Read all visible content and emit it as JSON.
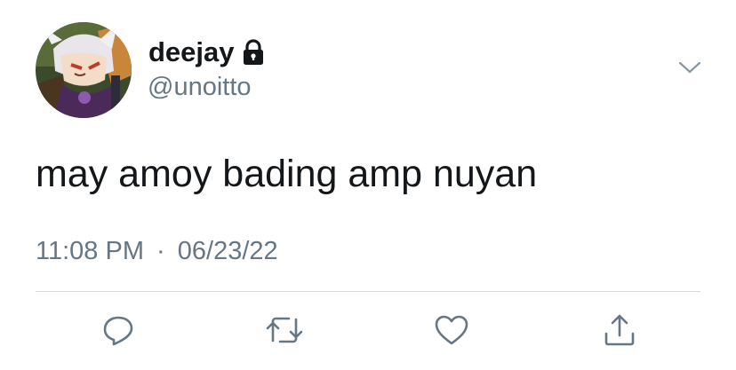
{
  "tweet": {
    "display_name": "deejay",
    "handle": "@unoitto",
    "text": "may amoy bading amp nuyan",
    "time": "11:08 PM",
    "separator": "·",
    "date": "06/23/22",
    "protected": true
  },
  "icons": {
    "lock": "lock-icon",
    "more": "chevron-down-icon",
    "reply": "reply-icon",
    "retweet": "retweet-icon",
    "like": "heart-icon",
    "share": "share-icon"
  },
  "colors": {
    "text_primary": "#14171a",
    "text_secondary": "#657786",
    "icon": "#657786",
    "divider": "#d6dadd"
  }
}
